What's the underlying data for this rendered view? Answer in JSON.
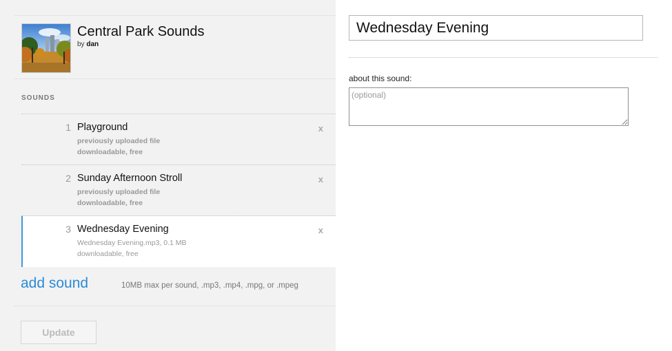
{
  "set": {
    "title": "Central Park Sounds",
    "by_prefix": "by",
    "author": "dan",
    "cover_icon": "park-landscape-image"
  },
  "sounds_heading": "SOUNDS",
  "sounds": [
    {
      "number": "1",
      "title": "Playground",
      "detail1": "previously uploaded file",
      "detail2": "downloadable, free",
      "remove_label": "x",
      "selected": false
    },
    {
      "number": "2",
      "title": "Sunday Afternoon Stroll",
      "detail1": "previously uploaded file",
      "detail2": "downloadable, free",
      "remove_label": "x",
      "selected": false
    },
    {
      "number": "3",
      "title": "Wednesday Evening",
      "detail1": "Wednesday Evening.mp3, 0.1 MB",
      "detail2": "downloadable, free",
      "remove_label": "x",
      "selected": true
    }
  ],
  "add_sound": {
    "label": "add sound",
    "hint": "10MB max per sound, .mp3, .mp4, .mpg, or .mpeg"
  },
  "update_button": "Update",
  "editor": {
    "title_value": "Wednesday Evening",
    "about_label": "about this sound:",
    "about_placeholder": "(optional)",
    "about_value": ""
  },
  "colors": {
    "accent": "#2a8bd6",
    "selected_bar": "#3a9ad9",
    "panel_bg": "#f2f2f2"
  }
}
